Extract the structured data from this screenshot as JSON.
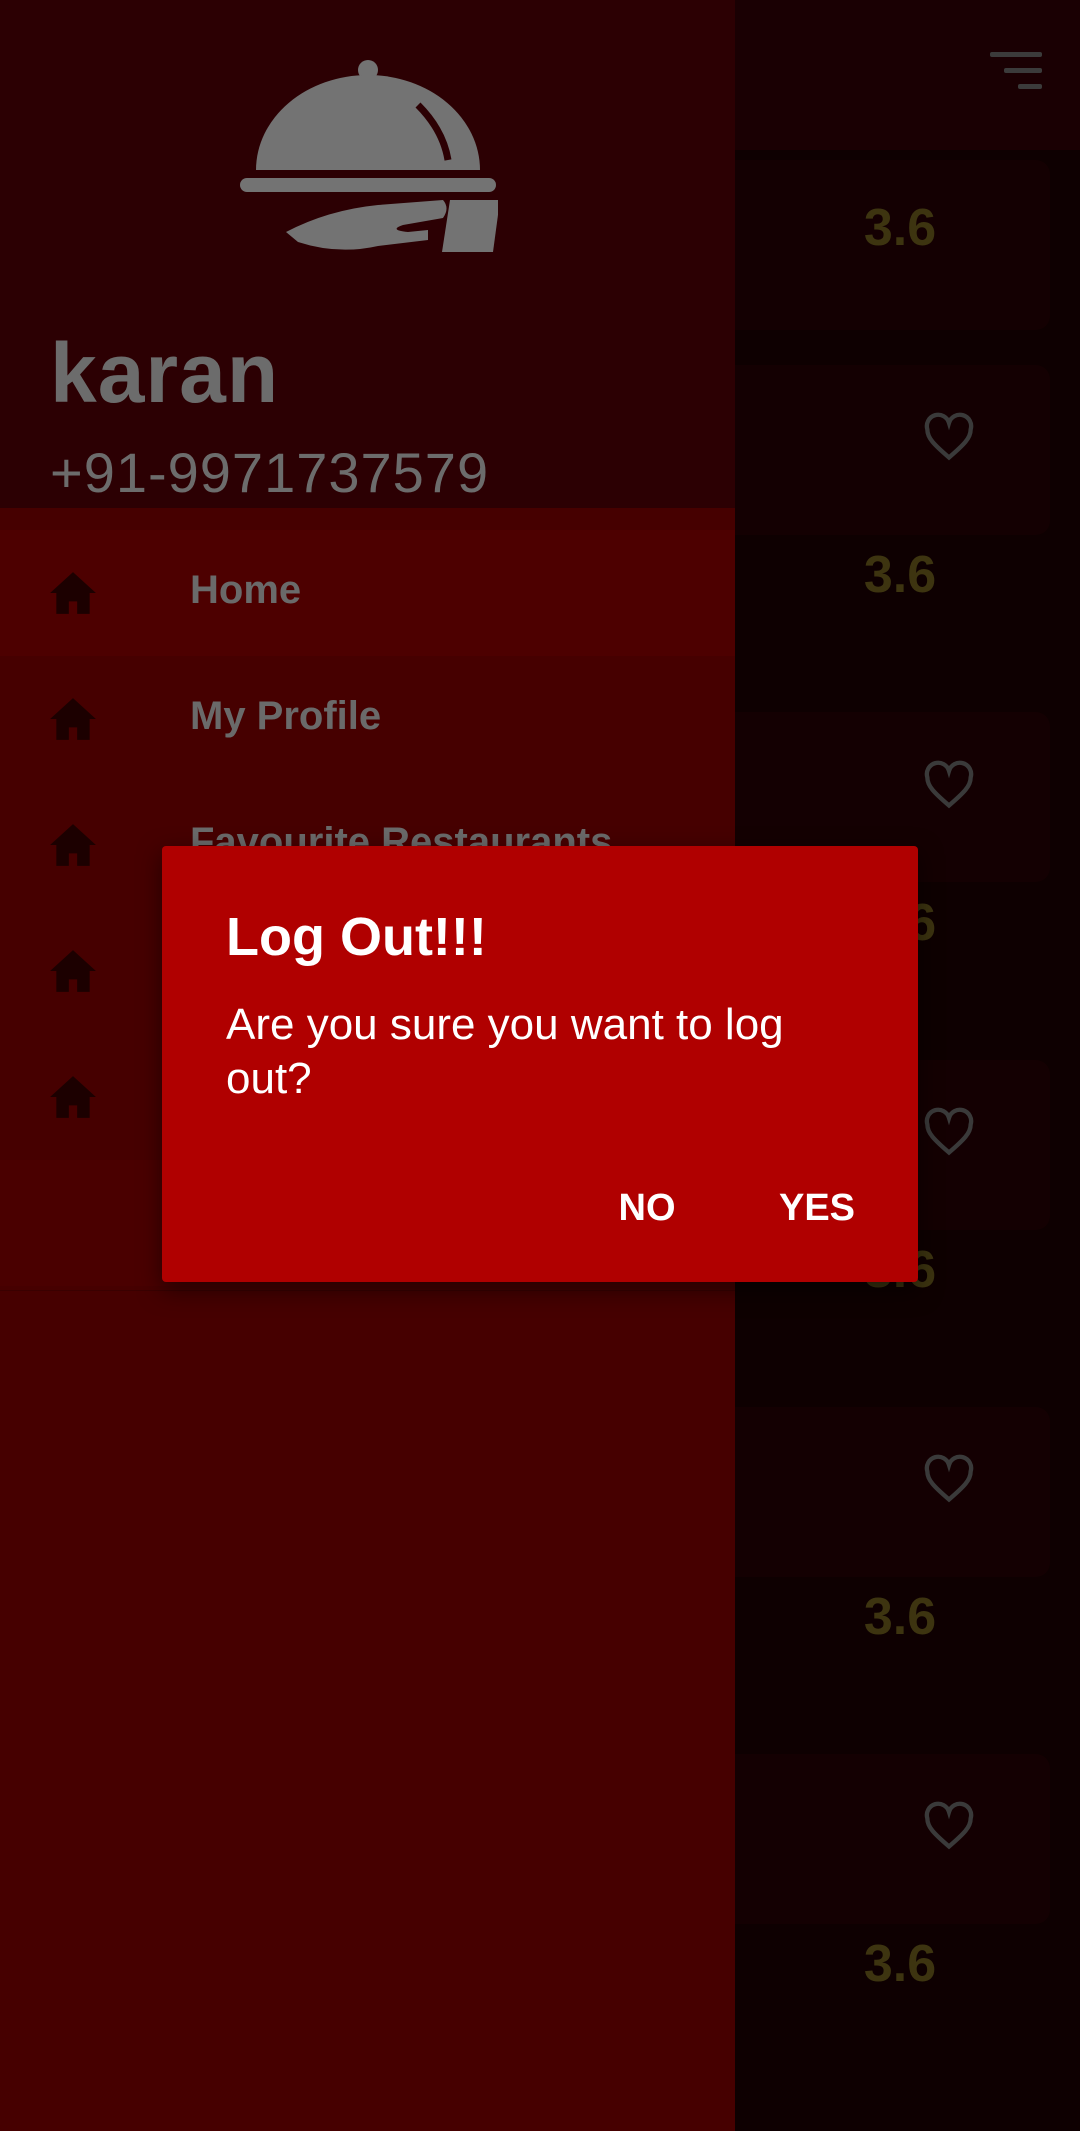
{
  "drawer": {
    "user_name": "karan",
    "user_phone": "+91-9971737579",
    "menu": [
      {
        "label": "Home",
        "icon": "home-icon"
      },
      {
        "label": "My Profile",
        "icon": "home-icon"
      },
      {
        "label": "Favourite Restaurants",
        "icon": "home-icon"
      },
      {
        "label": "",
        "icon": "home-icon"
      },
      {
        "label": "",
        "icon": "home-icon"
      },
      {
        "label": "",
        "icon": ""
      }
    ]
  },
  "restaurants": {
    "ratings": [
      "3.6",
      "3.6",
      "3.6",
      "3.6",
      "3.6",
      "3.6"
    ]
  },
  "dialog": {
    "title": "Log Out!!!",
    "message": "Are you sure you want to log out?",
    "no_label": "NO",
    "yes_label": "YES"
  },
  "colors": {
    "dialog_bg": "#b00000",
    "drawer_bg": "#460000",
    "drawer_header_bg": "#2c0003",
    "rating_text": "#3d3410"
  }
}
